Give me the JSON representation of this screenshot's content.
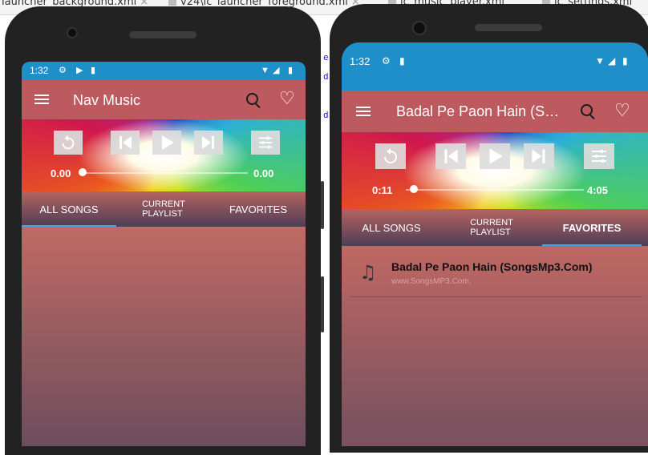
{
  "ide": {
    "tabs": [
      {
        "label": "launcher_background.xml"
      },
      {
        "label": "v24\\ic_launcher_foreground.xml"
      },
      {
        "label": "ic_music_player.xml"
      },
      {
        "label": "ic_settings.xml"
      }
    ]
  },
  "phone_left": {
    "status": {
      "time": "1:32"
    },
    "toolbar": {
      "title": "Nav Music"
    },
    "player": {
      "current_time": "0.00",
      "total_time": "0.00",
      "progress": 0
    },
    "tabs": [
      {
        "label": "ALL SONGS",
        "selected": true
      },
      {
        "label": "CURRENT\nPLAYLIST",
        "selected": false
      },
      {
        "label": "FAVORITES",
        "selected": false
      }
    ],
    "songs": []
  },
  "phone_right": {
    "status": {
      "time": "1:32"
    },
    "toolbar": {
      "title": "Badal Pe Paon Hain (SongsMp3.Com)"
    },
    "player": {
      "current_time": "0:11",
      "total_time": "4:05",
      "progress": 0.045
    },
    "tabs": [
      {
        "label": "ALL SONGS",
        "selected": false
      },
      {
        "label": "CURRENT\nPLAYLIST",
        "selected": false
      },
      {
        "label": "FAVORITES",
        "selected": true
      }
    ],
    "songs": [
      {
        "title": "Badal Pe Paon Hain (SongsMp3.Com)",
        "subtitle": "www.SongsMP3.Com,",
        "icon": "music-note-icon"
      }
    ]
  },
  "icons": {
    "menu": "menu-icon",
    "search": "search-icon",
    "favorite": "heart-icon",
    "repeat": "repeat-icon",
    "previous": "skip-previous-icon",
    "play": "play-icon",
    "next": "skip-next-icon",
    "equalizer": "equalizer-icon"
  },
  "colors": {
    "status_bar": "#1f8fc9",
    "toolbar": "#bc5a60",
    "tab_indicator": "#3da7e5",
    "content_top": "#c06a63",
    "content_bottom": "#6d4d5d"
  }
}
